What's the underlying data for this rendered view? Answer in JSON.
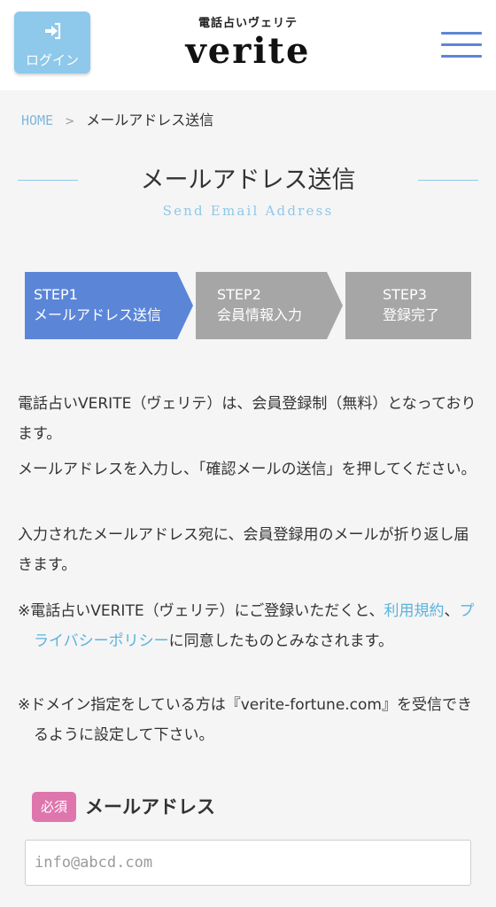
{
  "header": {
    "login_label": "ログイン",
    "logo_subtitle": "電話占いヴェリテ",
    "logo_title": "verite"
  },
  "breadcrumb": {
    "home": "HOME",
    "separator": ">",
    "current": "メールアドレス送信"
  },
  "page": {
    "title": "メールアドレス送信",
    "subtitle": "Send Email Address"
  },
  "steps": [
    {
      "number": "STEP1",
      "label": "メールアドレス送信",
      "active": true
    },
    {
      "number": "STEP2",
      "label": "会員情報入力",
      "active": false
    },
    {
      "number": "STEP3",
      "label": "登録完了",
      "active": false
    }
  ],
  "intro": {
    "p1": "電話占いVERITE（ヴェリテ）は、会員登録制（無料）となっております。",
    "p2": "メールアドレスを入力し、「確認メールの送信」を押してください。",
    "p3": "入力されたメールアドレス宛に、会員登録用のメールが折り返し届きます。"
  },
  "notes": {
    "note1_prefix": "※電話占いVERITE（ヴェリテ）にご登録いただくと、",
    "terms_link": "利用規約",
    "note1_comma": "、",
    "privacy_link": "プライバシーポリシー",
    "note1_suffix": "に同意したものとみなされます。",
    "note2": "※ドメイン指定をしている方は『verite-fortune.com』を受信できるように設定して下さい。"
  },
  "form": {
    "required_badge": "必須",
    "email_label": "メールアドレス",
    "email_placeholder": "info@abcd.com",
    "email_value": ""
  },
  "colors": {
    "accent_light_blue": "#8ec8ea",
    "link_blue": "#5bb3dd",
    "menu_blue": "#5e86d4",
    "step_active": "#5b86d8",
    "step_inactive": "#a6a6a6",
    "required_pink": "#de76ad",
    "background": "#f5f5f5"
  },
  "icons": {
    "login": "sign-in-icon",
    "menu": "hamburger-menu-icon"
  }
}
